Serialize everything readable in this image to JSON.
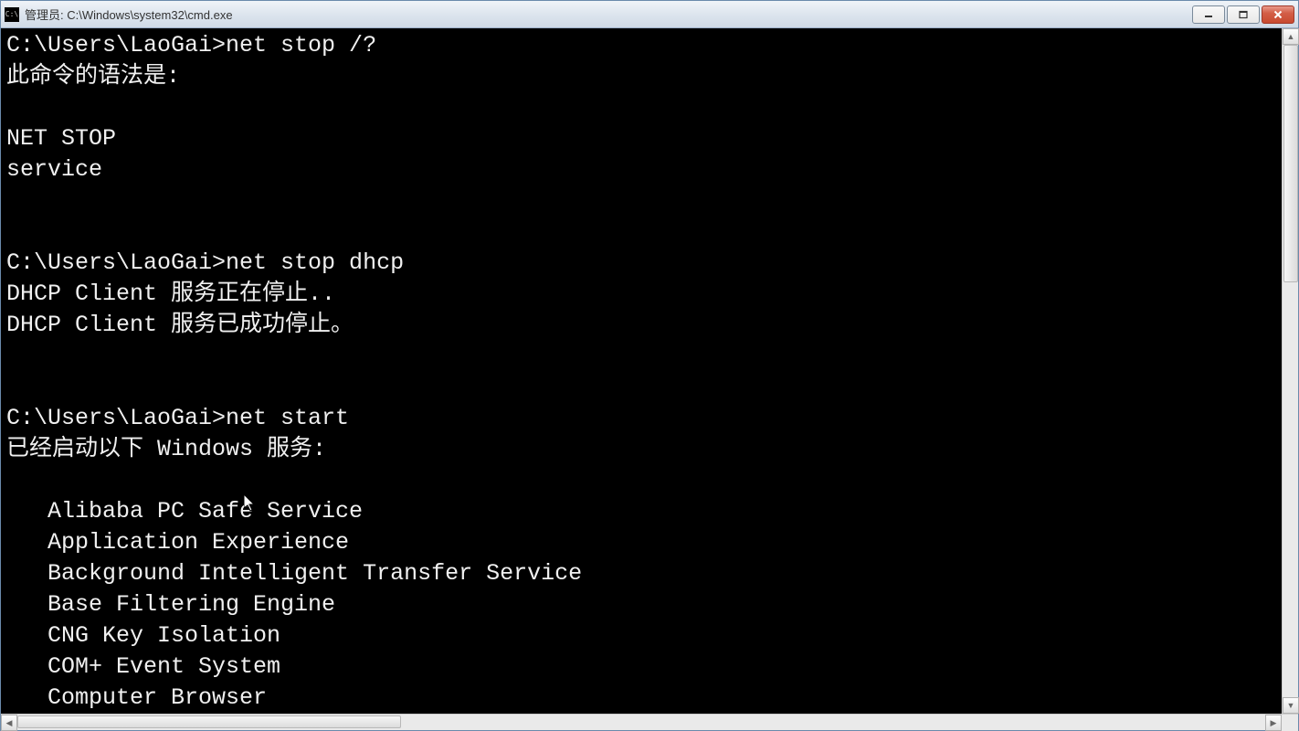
{
  "titlebar": {
    "icon_text": "C:\\",
    "title": "管理员: C:\\Windows\\system32\\cmd.exe"
  },
  "terminal": {
    "lines": [
      "C:\\Users\\LaoGai>net stop /?",
      "此命令的语法是:",
      "",
      "NET STOP",
      "service",
      "",
      "",
      "C:\\Users\\LaoGai>net stop dhcp",
      "DHCP Client 服务正在停止..",
      "DHCP Client 服务已成功停止。",
      "",
      "",
      "C:\\Users\\LaoGai>net start",
      "已经启动以下 Windows 服务:",
      "",
      "   Alibaba PC Safe Service",
      "   Application Experience",
      "   Background Intelligent Transfer Service",
      "   Base Filtering Engine",
      "   CNG Key Isolation",
      "   COM+ Event System",
      "   Computer Browser"
    ]
  },
  "window_controls": {
    "minimize": "minimize",
    "maximize": "maximize",
    "close": "close"
  }
}
